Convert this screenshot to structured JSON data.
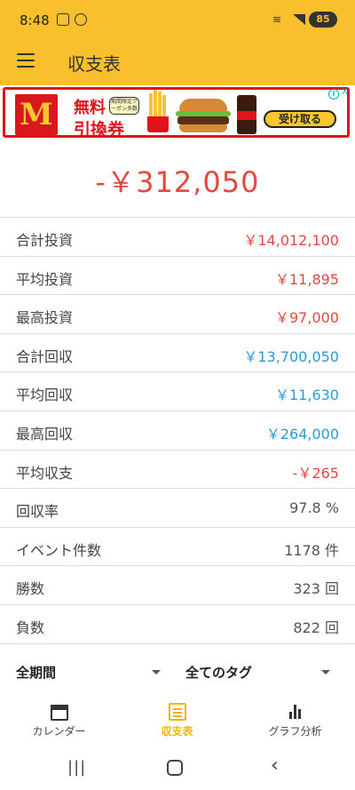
{
  "statusbar": {
    "time": "8:48",
    "battery": "85"
  },
  "header": {
    "title": "収支表"
  },
  "ad": {
    "logo_letter": "M",
    "text_line1": "無料",
    "text_line2": "引換券",
    "badge_text": "期間限定クーポン多数",
    "cta_label": "受け取る",
    "info_label": "i",
    "close_label": "X"
  },
  "summary": {
    "total": "-￥312,050"
  },
  "stats": [
    {
      "label": "合計投資",
      "value": "￥14,012,100",
      "color": "#e04a3f"
    },
    {
      "label": "平均投資",
      "value": "￥11,895",
      "color": "#e04a3f"
    },
    {
      "label": "最高投資",
      "value": "￥97,000",
      "color": "#e04a3f"
    },
    {
      "label": "合計回収",
      "value": "￥13,700,050",
      "color": "#2b9bd8"
    },
    {
      "label": "平均回収",
      "value": "￥11,630",
      "color": "#2b9bd8"
    },
    {
      "label": "最高回収",
      "value": "￥264,000",
      "color": "#2b9bd8"
    },
    {
      "label": "平均収支",
      "value": "-￥265",
      "color": "#e04a3f"
    },
    {
      "label": "回収率",
      "value": "97.8 %",
      "color": "#555555"
    },
    {
      "label": "イベント件数",
      "value": "1178 件",
      "color": "#555555"
    },
    {
      "label": "勝数",
      "value": "323 回",
      "color": "#555555"
    },
    {
      "label": "負数",
      "value": "822 回",
      "color": "#555555"
    }
  ],
  "filters": {
    "period": "全期間",
    "tags": "全てのタグ"
  },
  "bottom_nav": {
    "items": [
      {
        "label": "カレンダー",
        "icon": "calendar-icon"
      },
      {
        "label": "収支表",
        "icon": "list-icon",
        "active": true
      },
      {
        "label": "グラフ分析",
        "icon": "bar-chart-icon"
      }
    ]
  },
  "colors": {
    "accent": "#f9bf2c",
    "negative": "#e04a3f",
    "positive": "#2b9bd8"
  }
}
